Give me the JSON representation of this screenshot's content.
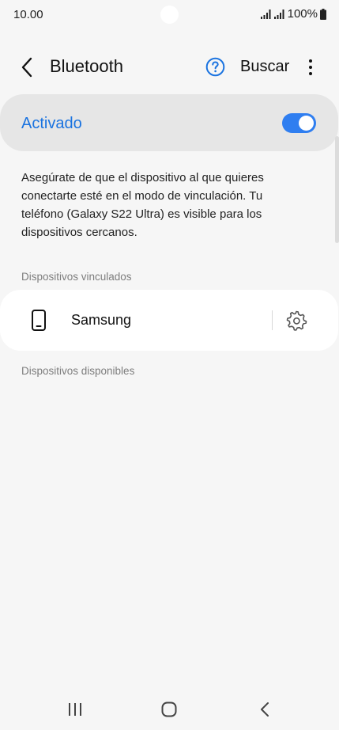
{
  "status_bar": {
    "time": "10.00",
    "battery": "100%"
  },
  "app_bar": {
    "title": "Bluetooth",
    "search_label": "Buscar"
  },
  "master_switch": {
    "label": "Activado",
    "on": true,
    "accent_color": "#1a73e0"
  },
  "description": "Asegúrate de que el dispositivo al que quieres conectarte esté en el modo de vinculación. Tu teléfono (Galaxy S22 Ultra) es visible para los dispositivos cercanos.",
  "paired_section": {
    "header": "Dispositivos vinculados",
    "devices": [
      {
        "name": "Samsung",
        "icon": "smartphone-icon"
      }
    ]
  },
  "available_section": {
    "header": "Dispositivos disponibles"
  },
  "icons": {
    "back": "chevron-left-icon",
    "help": "question-circle-icon",
    "more": "more-vertical-icon",
    "device_settings": "gear-icon"
  }
}
